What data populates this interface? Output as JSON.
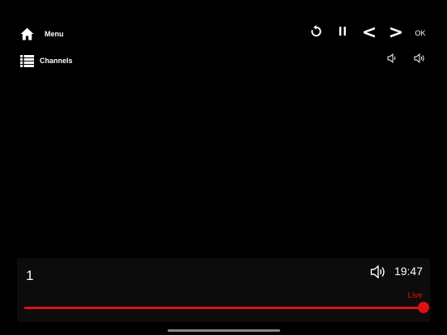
{
  "nav": {
    "menu_label": "Menu",
    "menu_icon": "home-icon",
    "channels_label": "Channels",
    "channels_icon": "list-icon"
  },
  "controls": {
    "refresh_icon": "refresh-icon",
    "pause_icon": "pause-icon",
    "prev_glyph": "<",
    "next_glyph": ">",
    "ok_label": "OK"
  },
  "volume": {
    "down_icon": "volume-down-icon",
    "up_icon": "volume-up-icon"
  },
  "player": {
    "channel_number": "1",
    "time": "19:47",
    "live_label": "Live",
    "progress": 1.0,
    "accent_color": "#e01010"
  }
}
